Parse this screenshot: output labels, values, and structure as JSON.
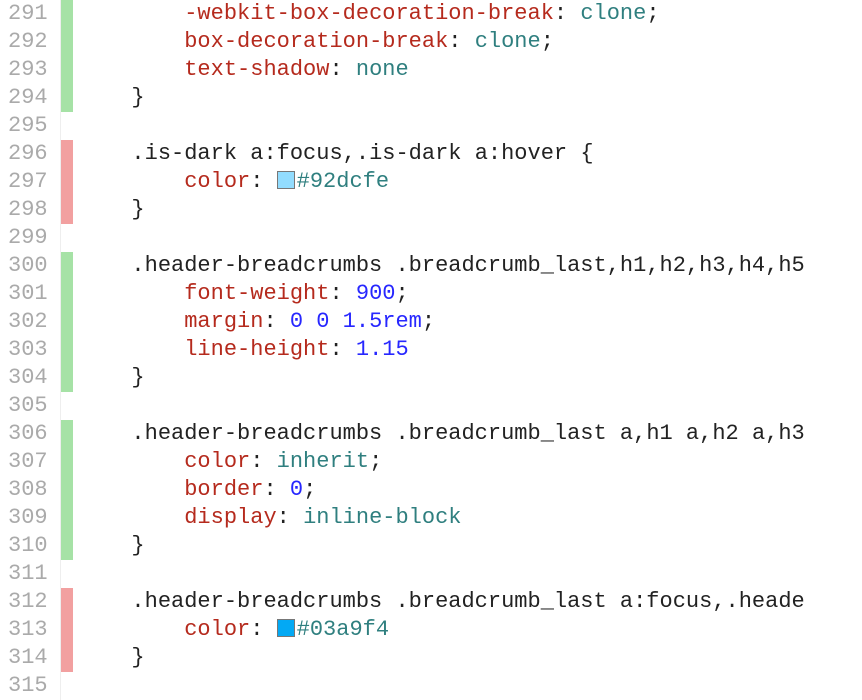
{
  "swatches": {
    "c1": "#92dcfe",
    "c2": "#03a9f4"
  },
  "lines": [
    {
      "num": 291,
      "marker": "green",
      "tokens": [
        {
          "t": "        "
        },
        {
          "t": "-webkit-box-decoration-break",
          "c": "tok-prop"
        },
        {
          "t": ": ",
          "c": "tok-punc"
        },
        {
          "t": "clone",
          "c": "tok-val"
        },
        {
          "t": ";",
          "c": "tok-punc"
        }
      ]
    },
    {
      "num": 292,
      "marker": "green",
      "tokens": [
        {
          "t": "        "
        },
        {
          "t": "box-decoration-break",
          "c": "tok-prop"
        },
        {
          "t": ": ",
          "c": "tok-punc"
        },
        {
          "t": "clone",
          "c": "tok-val"
        },
        {
          "t": ";",
          "c": "tok-punc"
        }
      ]
    },
    {
      "num": 293,
      "marker": "green",
      "tokens": [
        {
          "t": "        "
        },
        {
          "t": "text-shadow",
          "c": "tok-prop"
        },
        {
          "t": ": ",
          "c": "tok-punc"
        },
        {
          "t": "none",
          "c": "tok-val"
        }
      ]
    },
    {
      "num": 294,
      "marker": "green",
      "tokens": [
        {
          "t": "    "
        },
        {
          "t": "}",
          "c": "tok-punc"
        }
      ]
    },
    {
      "num": 295,
      "marker": "",
      "tokens": []
    },
    {
      "num": 296,
      "marker": "red",
      "tokens": [
        {
          "t": "    "
        },
        {
          "t": ".is-dark",
          "c": "tok-sel"
        },
        {
          "t": " "
        },
        {
          "t": "a:focus",
          "c": "tok-sel"
        },
        {
          "t": ",",
          "c": "tok-punc"
        },
        {
          "t": ".is-dark",
          "c": "tok-sel"
        },
        {
          "t": " "
        },
        {
          "t": "a:hover",
          "c": "tok-sel"
        },
        {
          "t": " {",
          "c": "tok-punc"
        }
      ]
    },
    {
      "num": 297,
      "marker": "red",
      "tokens": [
        {
          "t": "        "
        },
        {
          "t": "color",
          "c": "tok-prop"
        },
        {
          "t": ": ",
          "c": "tok-punc"
        },
        {
          "swatch": "c1"
        },
        {
          "t": "#92dcfe",
          "c": "tok-val"
        }
      ]
    },
    {
      "num": 298,
      "marker": "red",
      "tokens": [
        {
          "t": "    "
        },
        {
          "t": "}",
          "c": "tok-punc"
        }
      ]
    },
    {
      "num": 299,
      "marker": "",
      "tokens": []
    },
    {
      "num": 300,
      "marker": "green",
      "tokens": [
        {
          "t": "    "
        },
        {
          "t": ".header-breadcrumbs",
          "c": "tok-sel"
        },
        {
          "t": " "
        },
        {
          "t": ".breadcrumb_last",
          "c": "tok-sel"
        },
        {
          "t": ",",
          "c": "tok-punc"
        },
        {
          "t": "h1",
          "c": "tok-sel"
        },
        {
          "t": ",",
          "c": "tok-punc"
        },
        {
          "t": "h2",
          "c": "tok-sel"
        },
        {
          "t": ",",
          "c": "tok-punc"
        },
        {
          "t": "h3",
          "c": "tok-sel"
        },
        {
          "t": ",",
          "c": "tok-punc"
        },
        {
          "t": "h4",
          "c": "tok-sel"
        },
        {
          "t": ",",
          "c": "tok-punc"
        },
        {
          "t": "h5",
          "c": "tok-sel"
        }
      ]
    },
    {
      "num": 301,
      "marker": "green",
      "tokens": [
        {
          "t": "        "
        },
        {
          "t": "font-weight",
          "c": "tok-prop"
        },
        {
          "t": ": ",
          "c": "tok-punc"
        },
        {
          "t": "900",
          "c": "tok-num"
        },
        {
          "t": ";",
          "c": "tok-punc"
        }
      ]
    },
    {
      "num": 302,
      "marker": "green",
      "tokens": [
        {
          "t": "        "
        },
        {
          "t": "margin",
          "c": "tok-prop"
        },
        {
          "t": ": ",
          "c": "tok-punc"
        },
        {
          "t": "0",
          "c": "tok-num"
        },
        {
          "t": " "
        },
        {
          "t": "0",
          "c": "tok-num"
        },
        {
          "t": " "
        },
        {
          "t": "1.5rem",
          "c": "tok-num"
        },
        {
          "t": ";",
          "c": "tok-punc"
        }
      ]
    },
    {
      "num": 303,
      "marker": "green",
      "tokens": [
        {
          "t": "        "
        },
        {
          "t": "line-height",
          "c": "tok-prop"
        },
        {
          "t": ": ",
          "c": "tok-punc"
        },
        {
          "t": "1.15",
          "c": "tok-num"
        }
      ]
    },
    {
      "num": 304,
      "marker": "green",
      "tokens": [
        {
          "t": "    "
        },
        {
          "t": "}",
          "c": "tok-punc"
        }
      ]
    },
    {
      "num": 305,
      "marker": "",
      "tokens": []
    },
    {
      "num": 306,
      "marker": "green",
      "tokens": [
        {
          "t": "    "
        },
        {
          "t": ".header-breadcrumbs",
          "c": "tok-sel"
        },
        {
          "t": " "
        },
        {
          "t": ".breadcrumb_last",
          "c": "tok-sel"
        },
        {
          "t": " "
        },
        {
          "t": "a",
          "c": "tok-sel"
        },
        {
          "t": ",",
          "c": "tok-punc"
        },
        {
          "t": "h1",
          "c": "tok-sel"
        },
        {
          "t": " "
        },
        {
          "t": "a",
          "c": "tok-sel"
        },
        {
          "t": ",",
          "c": "tok-punc"
        },
        {
          "t": "h2",
          "c": "tok-sel"
        },
        {
          "t": " "
        },
        {
          "t": "a",
          "c": "tok-sel"
        },
        {
          "t": ",",
          "c": "tok-punc"
        },
        {
          "t": "h3",
          "c": "tok-sel"
        }
      ]
    },
    {
      "num": 307,
      "marker": "green",
      "tokens": [
        {
          "t": "        "
        },
        {
          "t": "color",
          "c": "tok-prop"
        },
        {
          "t": ": ",
          "c": "tok-punc"
        },
        {
          "t": "inherit",
          "c": "tok-val"
        },
        {
          "t": ";",
          "c": "tok-punc"
        }
      ]
    },
    {
      "num": 308,
      "marker": "green",
      "tokens": [
        {
          "t": "        "
        },
        {
          "t": "border",
          "c": "tok-prop"
        },
        {
          "t": ": ",
          "c": "tok-punc"
        },
        {
          "t": "0",
          "c": "tok-num"
        },
        {
          "t": ";",
          "c": "tok-punc"
        }
      ]
    },
    {
      "num": 309,
      "marker": "green",
      "tokens": [
        {
          "t": "        "
        },
        {
          "t": "display",
          "c": "tok-prop"
        },
        {
          "t": ": ",
          "c": "tok-punc"
        },
        {
          "t": "inline-block",
          "c": "tok-val"
        }
      ]
    },
    {
      "num": 310,
      "marker": "green",
      "tokens": [
        {
          "t": "    "
        },
        {
          "t": "}",
          "c": "tok-punc"
        }
      ]
    },
    {
      "num": 311,
      "marker": "",
      "tokens": []
    },
    {
      "num": 312,
      "marker": "red",
      "tokens": [
        {
          "t": "    "
        },
        {
          "t": ".header-breadcrumbs",
          "c": "tok-sel"
        },
        {
          "t": " "
        },
        {
          "t": ".breadcrumb_last",
          "c": "tok-sel"
        },
        {
          "t": " "
        },
        {
          "t": "a:focus",
          "c": "tok-sel"
        },
        {
          "t": ",",
          "c": "tok-punc"
        },
        {
          "t": ".heade",
          "c": "tok-sel"
        }
      ]
    },
    {
      "num": 313,
      "marker": "red",
      "tokens": [
        {
          "t": "        "
        },
        {
          "t": "color",
          "c": "tok-prop"
        },
        {
          "t": ": ",
          "c": "tok-punc"
        },
        {
          "swatch": "c2"
        },
        {
          "t": "#03a9f4",
          "c": "tok-val"
        }
      ]
    },
    {
      "num": 314,
      "marker": "red",
      "tokens": [
        {
          "t": "    "
        },
        {
          "t": "}",
          "c": "tok-punc"
        }
      ]
    },
    {
      "num": 315,
      "marker": "",
      "tokens": []
    }
  ]
}
